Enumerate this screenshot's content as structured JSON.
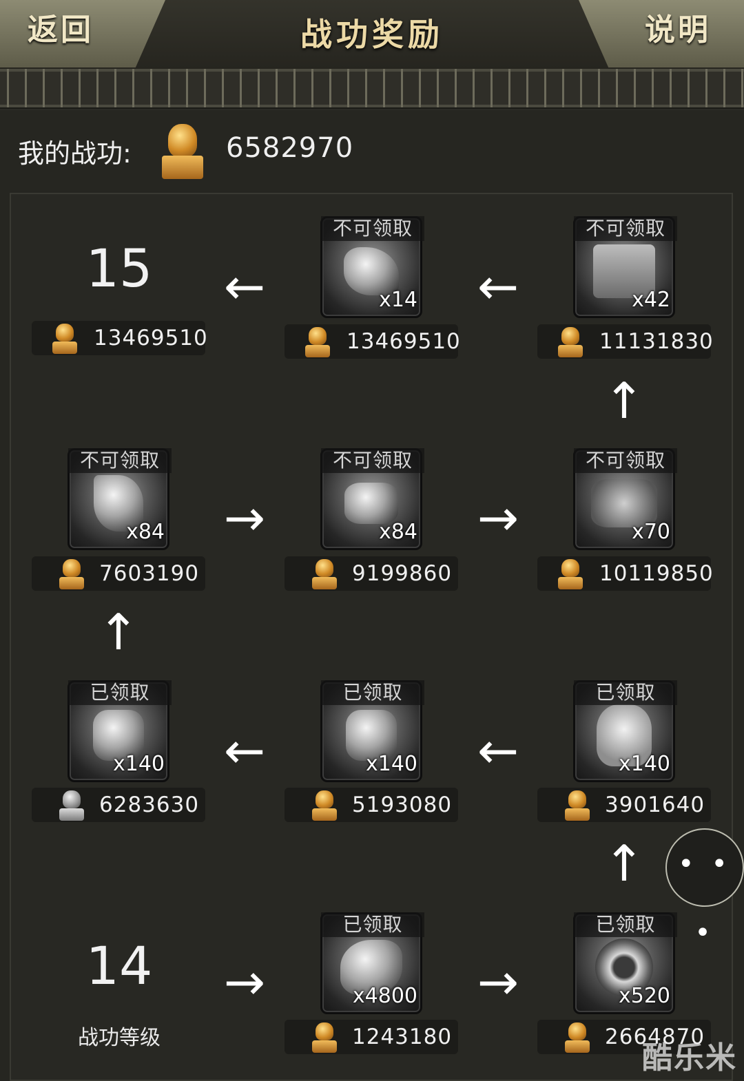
{
  "header": {
    "back_label": "返回",
    "title": "战功奖励",
    "help_label": "说明"
  },
  "my_merit": {
    "label": "我的战功:",
    "value": "6582970"
  },
  "levels": {
    "current_next": "15",
    "current": "14",
    "caption": "战功等级"
  },
  "status_labels": {
    "locked": "不可领取",
    "claimed": "已领取"
  },
  "nodes": [
    {
      "id": "r1c2",
      "status": "不可领取",
      "item_icon": "war-horse-icon",
      "qty": "x14",
      "cost": "13469510"
    },
    {
      "id": "r1c3",
      "status": "不可领取",
      "item_icon": "scroll-map-icon",
      "qty": "x42",
      "cost": "11131830"
    },
    {
      "id": "r2c1",
      "status": "不可领取",
      "item_icon": "crystal-cluster-icon",
      "qty": "x84",
      "cost": "7603190"
    },
    {
      "id": "r2c2",
      "status": "不可领取",
      "item_icon": "diamond-gem-icon",
      "qty": "x84",
      "cost": "9199860"
    },
    {
      "id": "r2c3",
      "status": "不可领取",
      "item_icon": "ore-chunk-icon",
      "qty": "x70",
      "cost": "10119850"
    },
    {
      "id": "r3c1",
      "status": "已领取",
      "item_icon": "jade-gem-icon",
      "qty": "x140",
      "cost": "6283630"
    },
    {
      "id": "r3c2",
      "status": "已领取",
      "item_icon": "jade-gem-icon",
      "qty": "x140",
      "cost": "5193080"
    },
    {
      "id": "r3c3",
      "status": "已领取",
      "item_icon": "white-stone-icon",
      "qty": "x140",
      "cost": "3901640"
    },
    {
      "id": "r4c2",
      "status": "已领取",
      "item_icon": "herb-bundle-icon",
      "qty": "x4800",
      "cost": "1243180"
    },
    {
      "id": "r4c3",
      "status": "已领取",
      "item_icon": "taiji-amulet-icon",
      "qty": "x520",
      "cost": "2664870"
    }
  ],
  "level15_cost": "13469510",
  "arrows": {
    "left": "←",
    "right": "→",
    "up": "↑"
  },
  "more_button": "• • •",
  "watermark": "酷乐米",
  "colors": {
    "gold_seal": "#d08a26",
    "title_gold": "#ecd9a6",
    "background": "#262621"
  }
}
